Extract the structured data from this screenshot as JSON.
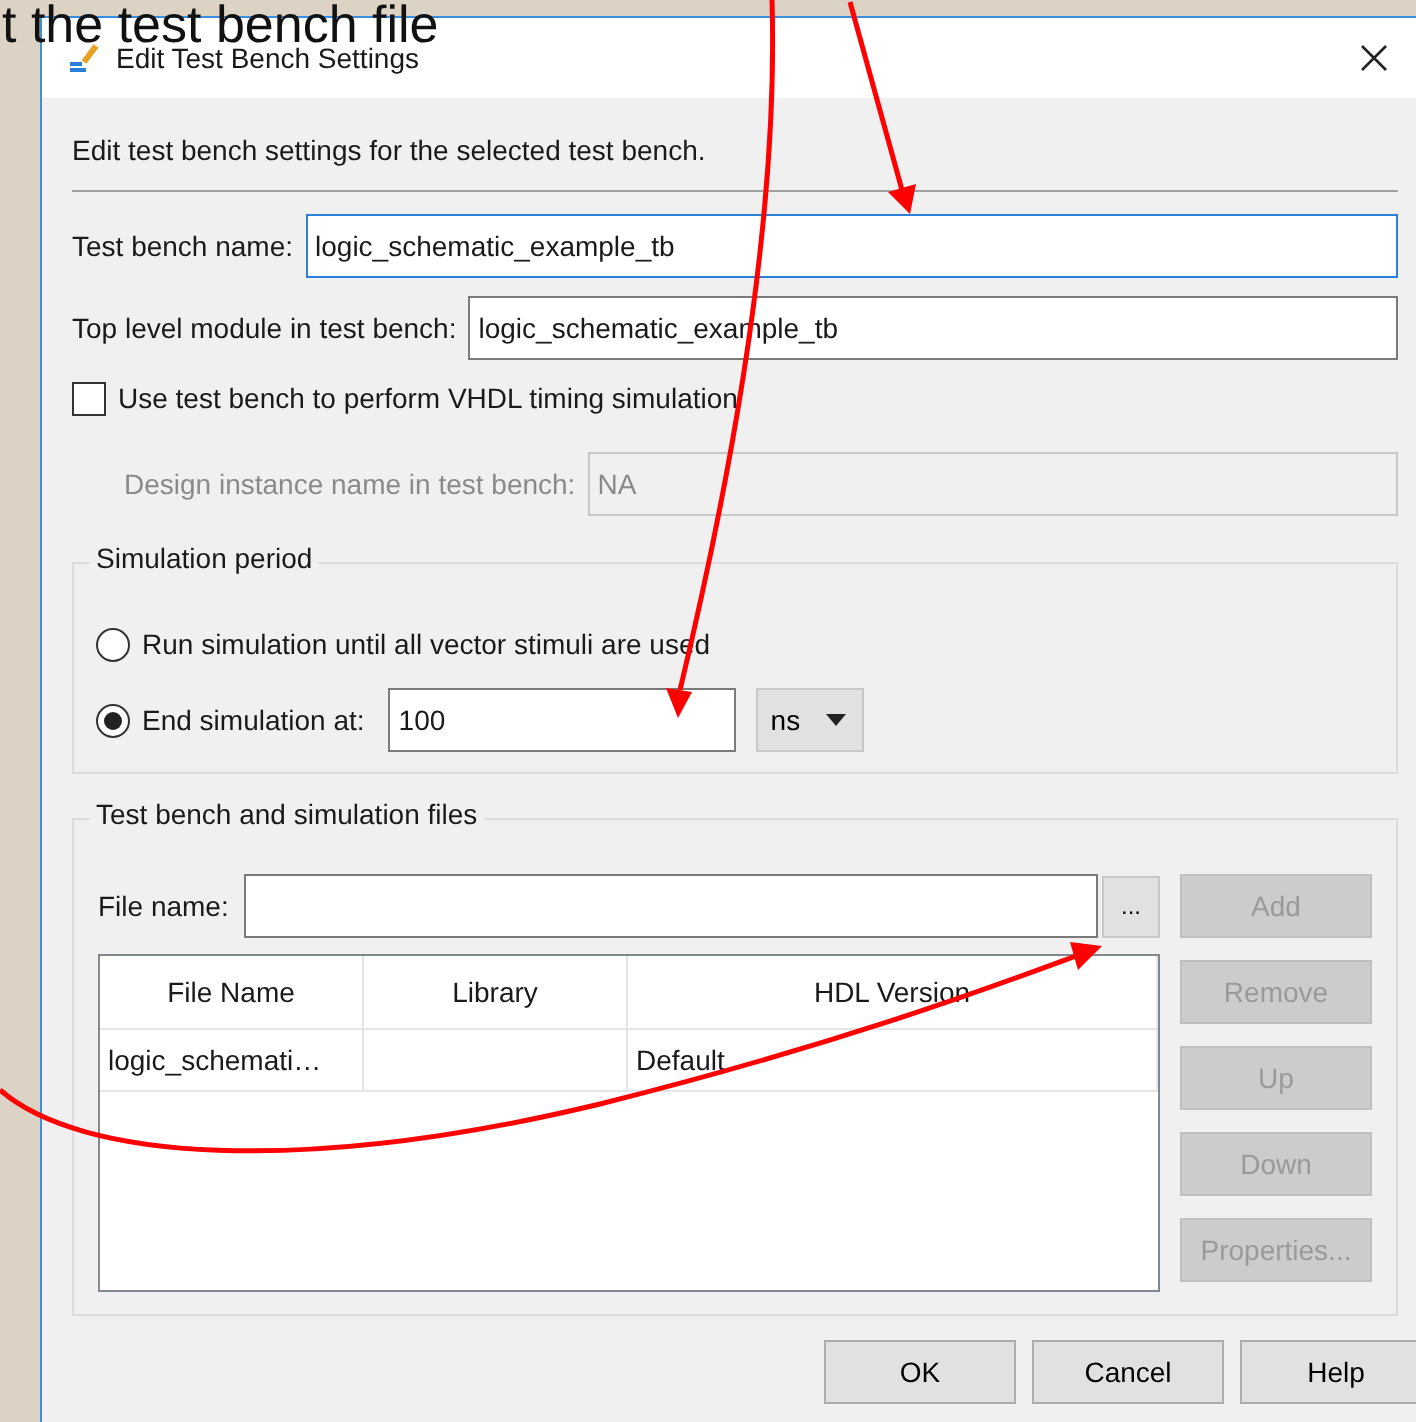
{
  "slide_title": "t the test bench file",
  "window": {
    "title": "Edit Test Bench Settings",
    "description": "Edit test bench settings for the selected test bench."
  },
  "test_bench_name": {
    "label": "Test bench name:",
    "value": "logic_schematic_example_tb",
    "focused": true
  },
  "top_level_module": {
    "label": "Top level module in test bench:",
    "value": "logic_schematic_example_tb",
    "focused": false
  },
  "vhdl_timing": {
    "label": "Use test bench to perform VHDL timing simulation",
    "checked": false
  },
  "design_instance": {
    "label": "Design instance name in test bench:",
    "value": "NA",
    "disabled": true
  },
  "simulation_period": {
    "title": "Simulation period",
    "options": [
      {
        "label": "Run simulation until all vector stimuli are used",
        "selected": false
      },
      {
        "label": "End simulation at:",
        "selected": true
      }
    ],
    "end_value": "100",
    "unit": "ns"
  },
  "files": {
    "title": "Test bench and simulation files",
    "file_name_label": "File name:",
    "browse": "...",
    "columns": [
      "File Name",
      "Library",
      "HDL Version"
    ],
    "rows": [
      {
        "file_name": "logic_schemati…",
        "library": null,
        "hdl_version": "Default"
      }
    ],
    "side_buttons": [
      {
        "label": "Add",
        "disabled": true
      },
      {
        "label": "Remove",
        "disabled": true
      },
      {
        "label": "Up",
        "disabled": true
      },
      {
        "label": "Down",
        "disabled": true
      },
      {
        "label": "Properties...",
        "disabled": true
      }
    ]
  },
  "buttons": [
    "OK",
    "Cancel",
    "Help"
  ]
}
